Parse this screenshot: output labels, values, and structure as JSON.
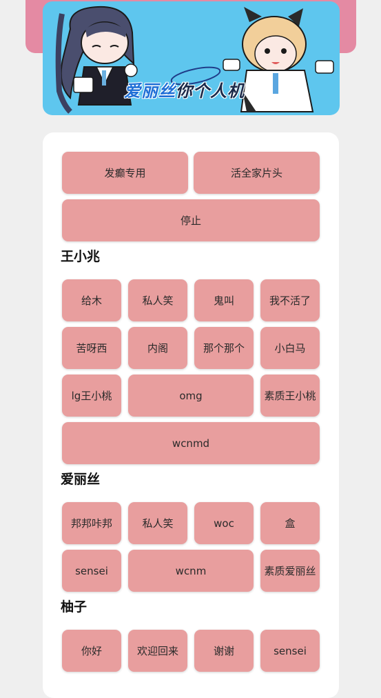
{
  "banner": {
    "title_blue": "爱丽丝",
    "title_dark": "你个人机"
  },
  "top_controls": {
    "btn1": "发癫专用",
    "btn2": "活全家片头",
    "stop": "停止"
  },
  "sections": {
    "s1": {
      "title": "王小兆",
      "buttons": [
        "给木",
        "私人笑",
        "鬼叫",
        "我不活了",
        "苦呀西",
        "内阁",
        "那个那个",
        "小白马",
        "lg王小桃",
        "omg",
        "素质王小桃",
        "wcnmd"
      ]
    },
    "s2": {
      "title": "爱丽丝",
      "buttons": [
        "邦邦咔邦",
        "私人笑",
        "woc",
        "盒",
        "sensei",
        "wcnm",
        "素质爱丽丝"
      ]
    },
    "s3": {
      "title": "柚子",
      "buttons": [
        "你好",
        "欢迎回来",
        "谢谢",
        "sensei"
      ]
    }
  },
  "colors": {
    "button": "#e89e9e",
    "banner_bg": "#5ec6ee",
    "banner_back": "#e48aa3",
    "page_bg": "#efefef"
  }
}
